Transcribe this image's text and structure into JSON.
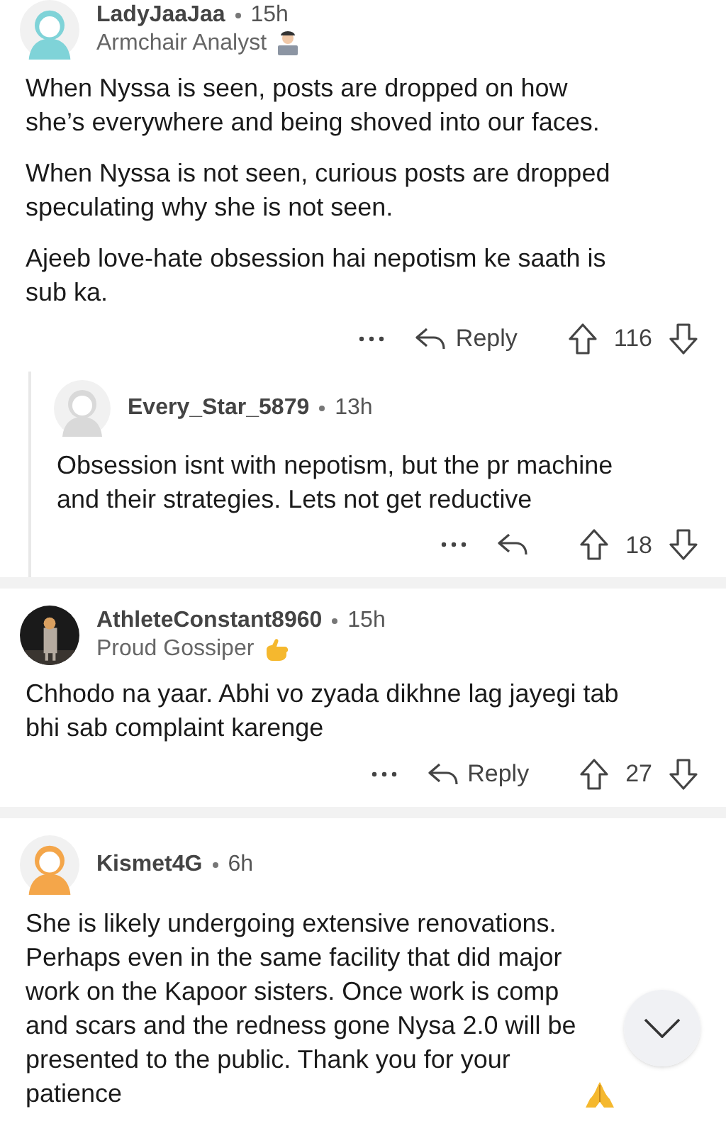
{
  "comments": [
    {
      "author": "LadyJaaJaa",
      "age": "15h",
      "flair": {
        "text": "Armchair Analyst",
        "kind": "laptop"
      },
      "avatar": {
        "kind": "cartoon"
      },
      "nested": false,
      "paragraphs": [
        "When Nyssa is seen, posts are dropped on how\nshe’s everywhere and being shoved into our faces.",
        "When Nyssa is not seen, curious posts are dropped\nspeculating why she is not seen.",
        "Ajeeb love-hate obsession hai nepotism ke saath is\nsub ka."
      ],
      "actions": {
        "reply_label": "Reply",
        "votes": "116"
      }
    },
    {
      "author": "Every_Star_5879",
      "age": "13h",
      "avatar": {
        "kind": "cartoon"
      },
      "nested": true,
      "paragraphs": [
        "Obsession isnt with nepotism, but the pr machine\nand their strategies. Lets not get reductive"
      ],
      "actions": {
        "votes": "18"
      }
    },
    {
      "author": "AthleteConstant8960",
      "age": "15h",
      "flair": {
        "text": "Proud Gossiper",
        "kind": "hand"
      },
      "nested": false,
      "paragraphs": [
        "Chhodo na yaar. Abhi vo zyada dikhne lag jayegi tab\nbhi sab complaint karenge"
      ],
      "actions": {
        "reply_label": "Reply",
        "votes": "27"
      }
    },
    {
      "author": "Kismet4G",
      "age": "6h",
      "avatar": {
        "kind": "cartoon"
      },
      "nested": false,
      "paragraphs": [
        "She is likely undergoing extensive renovations.\nPerhaps even in the same facility that did major\nwork on the Kapoor sisters. Once work is comp\nand scars and the redness gone Nysa 2.0 will be\npresented to the public.  Thank you for your\npatience"
      ]
    }
  ]
}
